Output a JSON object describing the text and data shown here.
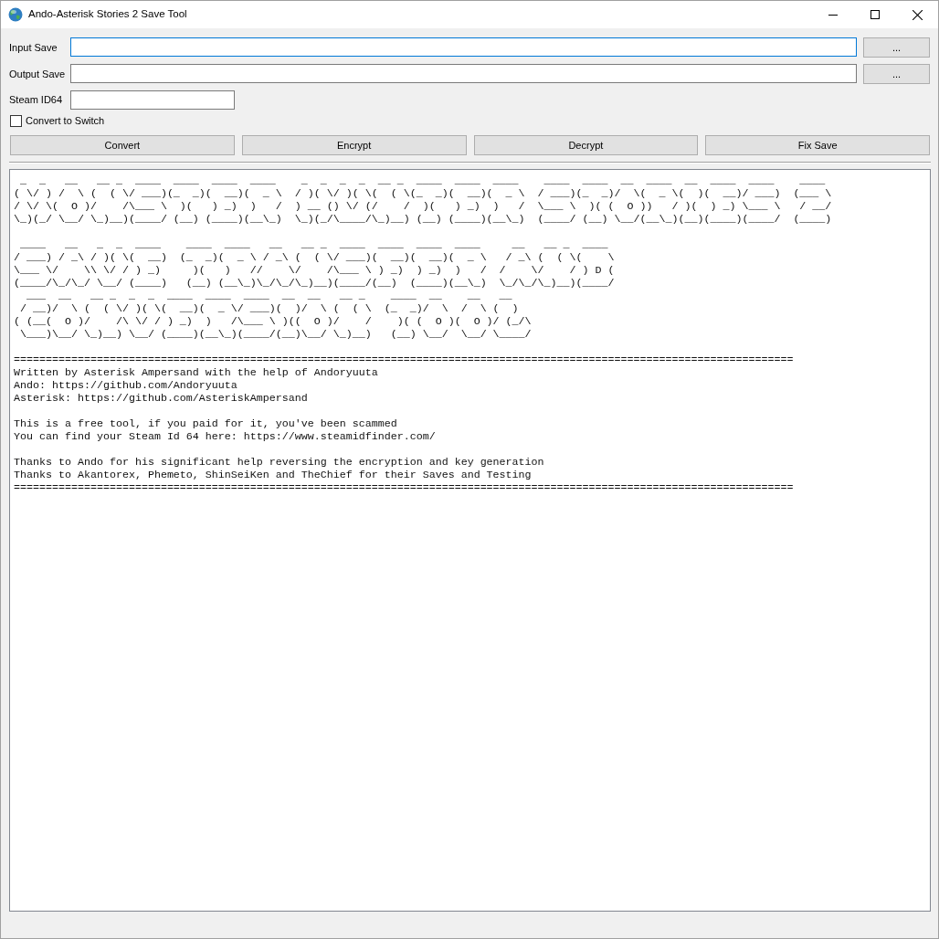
{
  "window": {
    "title": "Ando-Asterisk Stories 2 Save Tool"
  },
  "fields": [
    {
      "kind": "file",
      "label": "Input Save",
      "focused": true,
      "button": "..."
    },
    {
      "kind": "file",
      "label": "Output Save",
      "focused": false,
      "button": "..."
    },
    {
      "kind": "text",
      "label": "Steam ID64",
      "focused": false
    }
  ],
  "checkbox": {
    "label": "Convert to Switch",
    "checked": false
  },
  "actions": [
    "Convert",
    "Encrypt",
    "Decrypt",
    "Fix Save"
  ],
  "output_log": {
    "paragraphs": [
      [
        {
          "kind": "art",
          "lines": [
            " _  _   __   __ _  ____  ____  ____  ____    _  _  _  _  __ _  ____  ____  ____    ____  ____  __  ____  __  ____  ____    ____",
            "( \\/ ) /  \\ (  ( \\/ ___)(_  _)(  __)(  _ \\  / )( \\/ )( \\(  ( \\(_  _)(  __)(  _ \\  / ___)(_  _)/  \\(  _ \\(  )(  __)/ ___)  (___ \\",
            "/ \\/ \\(  O )/    /\\___ \\  )(   ) _)  )   /  ) __ () \\/ (/    /  )(   ) _)  )   /  \\___ \\  )( (  O ))   / )(  ) _) \\___ \\   / __/",
            "\\_)(_/ \\__/ \\_)__)(____/ (__) (____)(__\\_)  \\_)(_/\\____/\\_)__) (__) (____)(__\\_)  (____/ (__) \\__/(__\\_)(__)(____)(____/  (____)"
          ]
        }
      ],
      [
        {
          "kind": "art",
          "lines": [
            " ____   __   _  _  ____    ____  ____   __   __ _  ____  ____  ____  ____     __   __ _  ____",
            "/ ___) / _\\ / )( \\(  __)  (_  _)(  _ \\ / _\\ (  ( \\/ ___)(  __)(  __)(  _ \\   / _\\ (  ( \\(    \\",
            "\\___ \\/    \\\\ \\/ / ) _)     )(   )   //    \\/    /\\___ \\ ) _)  ) _)  )   /  /    \\/    / ) D (",
            "(____/\\_/\\_/ \\__/ (____)   (__) (__\\_)\\_/\\_/\\_)__)(____/(__)  (____)(__\\_)  \\_/\\_/\\_)__)(____/",
            "  ___  __   __ _  _  _  ____  ____  ____  __  __   __ _    ____  __    __   __",
            " / __)/  \\ (  ( \\/ )( \\(  __)(  _ \\/ ___)(  )/  \\ (  ( \\  (_  _)/  \\  /  \\ (  )",
            "( (__(  O )/    /\\ \\/ / ) _)  )   /\\___ \\ )((  O )/    /    )( (  O )(  O )/ (_/\\",
            " \\___)\\__/ \\_)__) \\__/ (____)(__\\_)(____/(__)\\__/ \\_)__)   (__) \\__/  \\__/ \\____/"
          ]
        }
      ],
      [
        {
          "kind": "rule",
          "text": "=========================================================================================================================="
        },
        {
          "kind": "line",
          "text": "Written by Asterisk Ampersand with the help of Andoryuuta"
        },
        {
          "kind": "line",
          "text": "Ando: https://github.com/Andoryuuta"
        },
        {
          "kind": "line",
          "text": "Asterisk: https://github.com/AsteriskAmpersand"
        }
      ],
      [
        {
          "kind": "line",
          "text": "This is a free tool, if you paid for it, you've been scammed"
        },
        {
          "kind": "line",
          "text": "You can find your Steam Id 64 here: https://www.steamidfinder.com/"
        }
      ],
      [
        {
          "kind": "line",
          "text": "Thanks to Ando for his significant help reversing the encryption and key generation"
        },
        {
          "kind": "line",
          "text": "Thanks to Akantorex, Phemeto, ShinSeiKen and TheChief for their Saves and Testing"
        },
        {
          "kind": "rule",
          "text": "=========================================================================================================================="
        }
      ]
    ]
  }
}
